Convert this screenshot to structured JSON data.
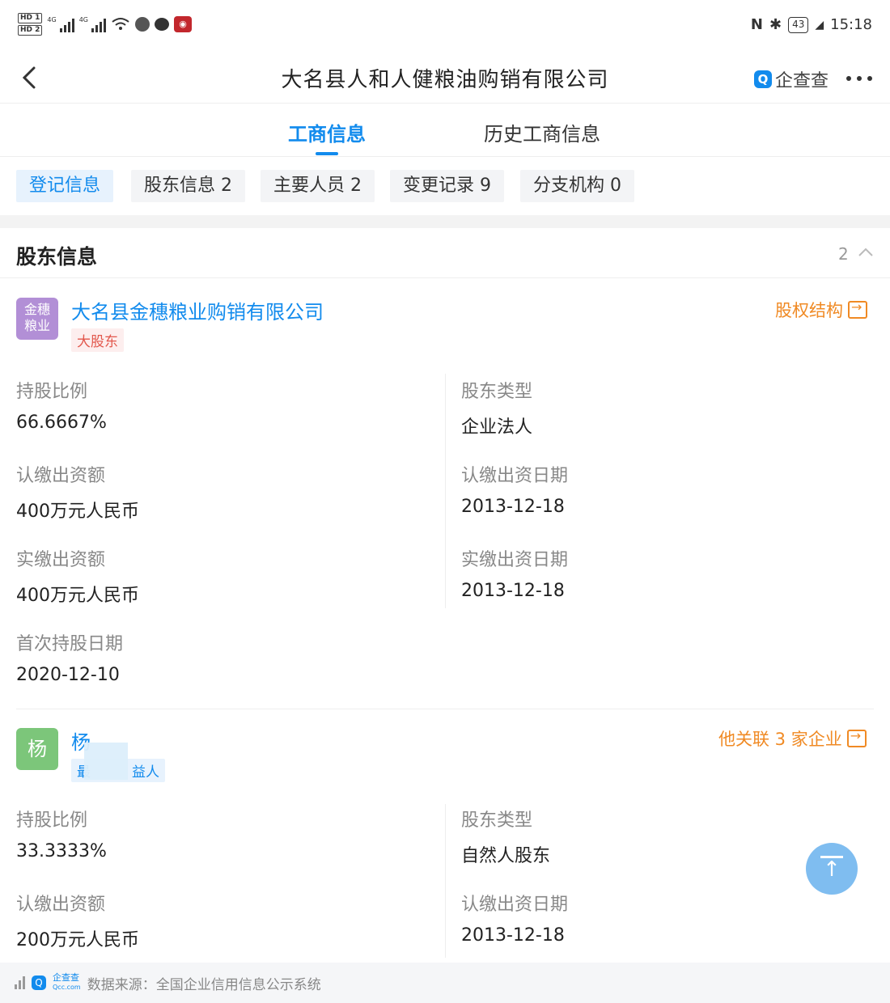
{
  "status_bar": {
    "hd1": "HD 1",
    "hd2": "HD 2",
    "net1": "4G",
    "net2": "4G",
    "battery": "43",
    "time": "15:18"
  },
  "nav": {
    "title": "大名县人和人健粮油购销有限公司",
    "brand": "企查查",
    "brand_logo": "Q"
  },
  "tabs": [
    {
      "label": "工商信息",
      "active": true
    },
    {
      "label": "历史工商信息",
      "active": false
    }
  ],
  "chips": [
    {
      "label": "登记信息",
      "active": true
    },
    {
      "label": "股东信息 2",
      "active": false
    },
    {
      "label": "主要人员 2",
      "active": false
    },
    {
      "label": "变更记录 9",
      "active": false
    },
    {
      "label": "分支机构 0",
      "active": false
    }
  ],
  "section": {
    "title": "股东信息",
    "count": "2"
  },
  "shareholders": [
    {
      "avatar_line1": "金穗",
      "avatar_line2": "粮业",
      "name": "大名县金穗粮业购销有限公司",
      "tag": "大股东",
      "link": "股权结构",
      "fields": {
        "ratio_label": "持股比例",
        "ratio": "66.6667%",
        "type_label": "股东类型",
        "type": "企业法人",
        "sub_amount_label": "认缴出资额",
        "sub_amount": "400万元人民币",
        "sub_date_label": "认缴出资日期",
        "sub_date": "2013-12-18",
        "paid_amount_label": "实缴出资额",
        "paid_amount": "400万元人民币",
        "paid_date_label": "实缴出资日期",
        "paid_date": "2013-12-18",
        "first_date_label": "首次持股日期",
        "first_date": "2020-12-10"
      }
    },
    {
      "avatar": "杨",
      "name": "杨",
      "tag": "最　　　益人",
      "link": "他关联 3 家企业",
      "fields": {
        "ratio_label": "持股比例",
        "ratio": "33.3333%",
        "type_label": "股东类型",
        "type": "自然人股东",
        "sub_amount_label": "认缴出资额",
        "sub_amount": "200万元人民币",
        "sub_date_label": "认缴出资日期",
        "sub_date": "2013-12-18"
      }
    }
  ],
  "footer": {
    "brand": "企查查",
    "brand_sub": "Qcc.com",
    "source": "数据来源：全国企业信用信息公示系统"
  },
  "colors": {
    "accent": "#128bed",
    "orange": "#f08a24",
    "org_avatar": "#b28fd6",
    "person_avatar": "#7cc67a",
    "tag_red": "#e2574c"
  }
}
